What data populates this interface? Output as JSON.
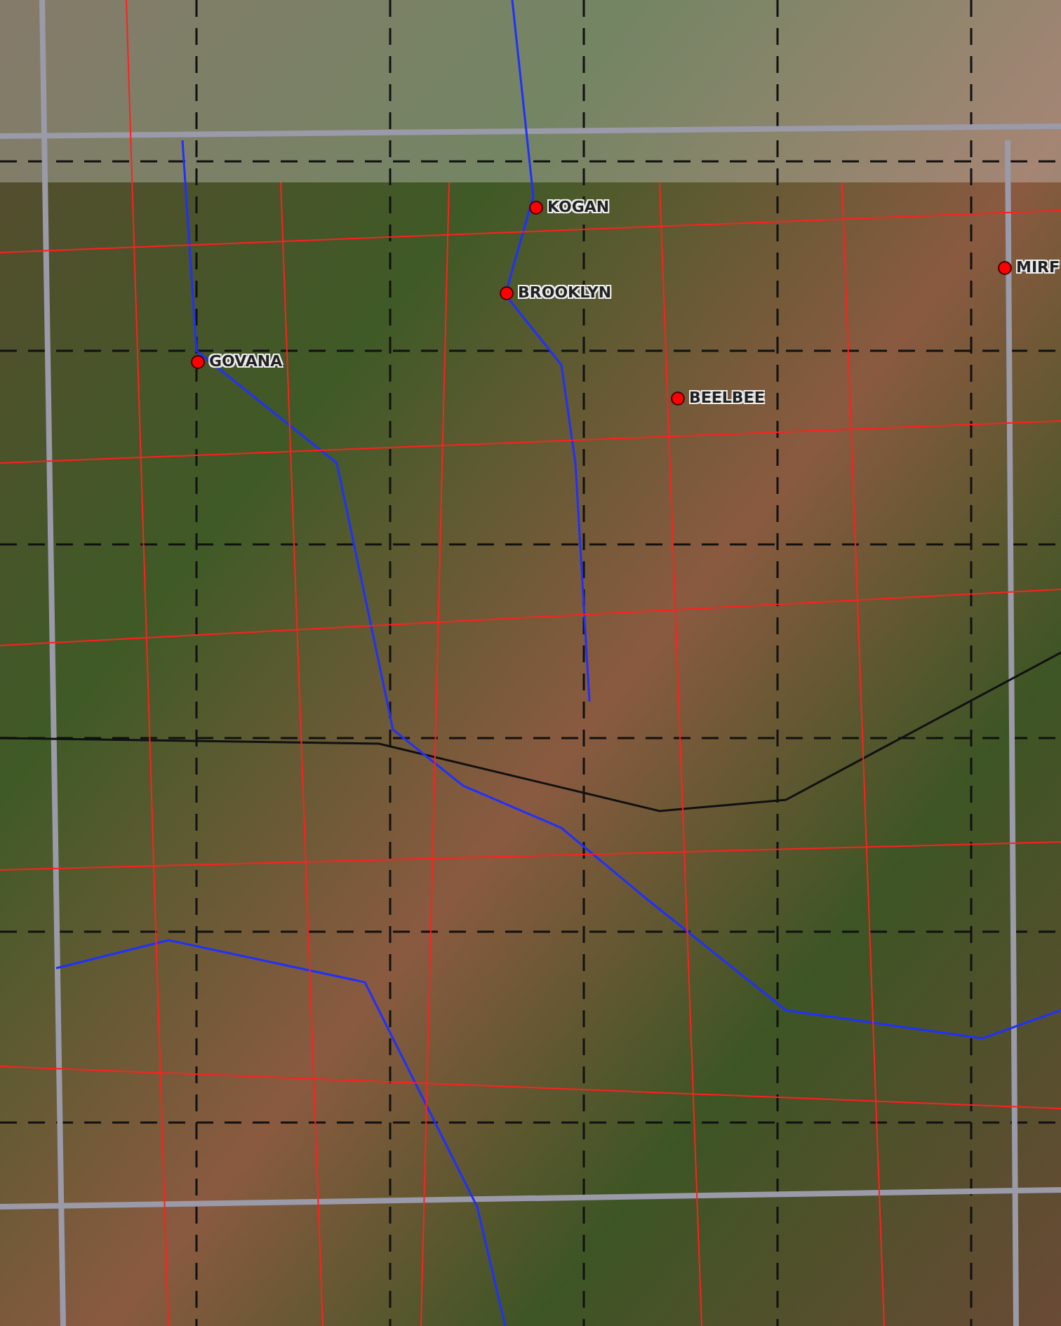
{
  "map": {
    "places": [
      {
        "name": "KOGAN"
      },
      {
        "name": "BROOKLYN"
      },
      {
        "name": "GOVANA"
      },
      {
        "name": "BEELBEE"
      },
      {
        "name": "MIRF"
      }
    ]
  }
}
